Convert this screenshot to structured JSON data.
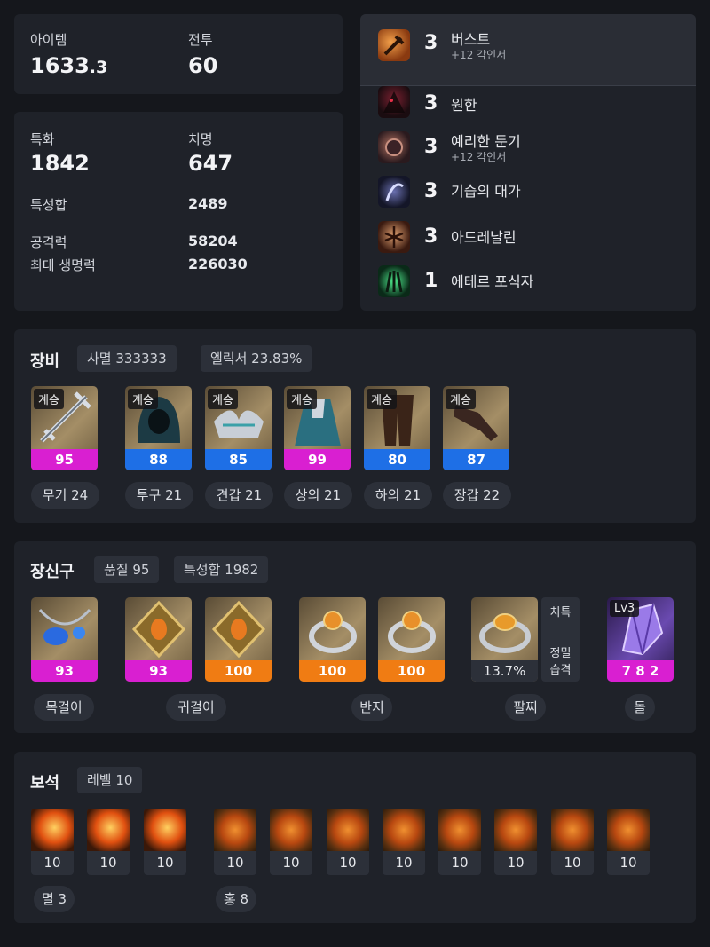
{
  "stats_top": {
    "item_label": "아이템",
    "item_level_main": "1633",
    "item_level_dec": ".3",
    "combat_label": "전투",
    "combat_level": "60"
  },
  "stats_mid": {
    "spec_label": "특화",
    "spec_value": "1842",
    "crit_label": "치명",
    "crit_value": "647",
    "trait_sum_label": "특성합",
    "trait_sum_value": "2489",
    "attack_label": "공격력",
    "attack_value": "58204",
    "hp_label": "최대 생명력",
    "hp_value": "226030"
  },
  "engravings": [
    {
      "level": "3",
      "name": "버스트",
      "sub": "+12 각인서",
      "icon": "burst-icon"
    },
    {
      "level": "3",
      "name": "원한",
      "sub": "",
      "icon": "grudge-icon"
    },
    {
      "level": "3",
      "name": "예리한 둔기",
      "sub": "+12 각인서",
      "icon": "keen-blunt-icon"
    },
    {
      "level": "3",
      "name": "기습의 대가",
      "sub": "",
      "icon": "ambush-master-icon"
    },
    {
      "level": "3",
      "name": "아드레날린",
      "sub": "",
      "icon": "adrenaline-icon"
    },
    {
      "level": "1",
      "name": "에테르 포식자",
      "sub": "",
      "icon": "ether-predator-icon"
    }
  ],
  "equipment": {
    "title": "장비",
    "chips": [
      "사멸 333333",
      "엘릭서 23.83%"
    ],
    "items": [
      {
        "tag": "계승",
        "quality": "95",
        "label": "무기 24",
        "icon": "weapon-icon",
        "color": "#d91fd1"
      },
      {
        "tag": "계승",
        "quality": "88",
        "label": "투구 21",
        "icon": "helmet-icon",
        "color": "#1e6fe6"
      },
      {
        "tag": "계승",
        "quality": "85",
        "label": "견갑 21",
        "icon": "shoulder-icon",
        "color": "#1e6fe6"
      },
      {
        "tag": "계승",
        "quality": "99",
        "label": "상의 21",
        "icon": "chest-icon",
        "color": "#d91fd1"
      },
      {
        "tag": "계승",
        "quality": "80",
        "label": "하의 21",
        "icon": "pants-icon",
        "color": "#1e6fe6"
      },
      {
        "tag": "계승",
        "quality": "87",
        "label": "장갑 22",
        "icon": "gloves-icon",
        "color": "#1e6fe6"
      }
    ]
  },
  "accessories": {
    "title": "장신구",
    "chips": [
      "품질 95",
      "특성합 1982"
    ],
    "items": [
      {
        "quality": "93",
        "icon": "necklace-icon",
        "color": "#d91fd1"
      },
      {
        "quality": "93",
        "icon": "earring-icon",
        "color": "#d91fd1"
      },
      {
        "quality": "100",
        "icon": "earring-icon",
        "color": "#f07c13"
      },
      {
        "quality": "100",
        "icon": "ring-icon",
        "color": "#f07c13"
      },
      {
        "quality": "100",
        "icon": "ring-icon",
        "color": "#f07c13"
      }
    ],
    "bracelet": {
      "value": "13.7%",
      "stats": [
        "치특",
        "정밀",
        "습격"
      ],
      "icon": "bracelet-icon"
    },
    "stone": {
      "level": "Lv3",
      "value": "7 8 2",
      "icon": "ability-stone-icon",
      "color": "#d91fd1"
    },
    "labels": [
      "목걸이",
      "귀걸이",
      "반지",
      "팔찌",
      "돌"
    ]
  },
  "gems": {
    "title": "보석",
    "chip": "레벨 10",
    "levels": [
      "10",
      "10",
      "10",
      "10",
      "10",
      "10",
      "10",
      "10",
      "10",
      "10",
      "10"
    ],
    "groups": [
      "멸 3",
      "홍 8"
    ]
  }
}
